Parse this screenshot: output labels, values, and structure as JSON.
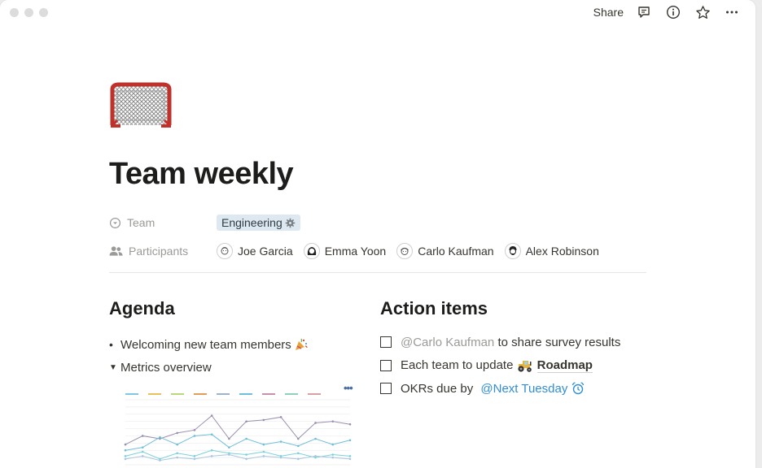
{
  "topbar": {
    "share_label": "Share",
    "icons": [
      "comment-icon",
      "info-icon",
      "star-icon",
      "more-icon"
    ]
  },
  "page": {
    "icon": "hockey-goal-icon",
    "title": "Team weekly"
  },
  "properties": {
    "team": {
      "label": "Team",
      "value": "Engineering"
    },
    "participants": {
      "label": "Participants",
      "people": [
        "Joe Garcia",
        "Emma Yoon",
        "Carlo Kaufman",
        "Alex Robinson"
      ]
    }
  },
  "agenda": {
    "heading": "Agenda",
    "items": [
      {
        "text": "Welcoming new team members",
        "emoji": "party-popper-icon"
      },
      {
        "text": "Metrics overview",
        "toggle": true
      }
    ]
  },
  "action_items": {
    "heading": "Action items",
    "items": [
      {
        "mention": "@Carlo Kaufman",
        "text": " to share survey results"
      },
      {
        "text": "Each team to update ",
        "link": "Roadmap",
        "link_icon": "tractor-icon"
      },
      {
        "text": "OKRs due by ",
        "date": "@Next Tuesday",
        "date_icon": "alarm-clock-icon"
      }
    ]
  },
  "colors": {
    "tag_bg": "#dde8f0",
    "mention_blue": "#2f8ed6",
    "muted": "#9b9a97"
  },
  "chart_data": {
    "type": "line",
    "x": [
      1,
      2,
      3,
      4,
      5,
      6,
      7,
      8,
      9,
      10,
      11,
      12,
      13,
      14
    ],
    "series": [
      {
        "values": [
          14,
          20,
          18,
          22,
          24,
          34,
          18,
          30,
          31,
          33,
          18,
          29,
          30,
          28
        ]
      },
      {
        "values": [
          10,
          12,
          19,
          14,
          20,
          21,
          12,
          18,
          14,
          16,
          13,
          18,
          14,
          17
        ]
      },
      {
        "values": [
          6,
          9,
          4,
          8,
          6,
          10,
          8,
          7,
          9,
          6,
          8,
          5,
          7,
          6
        ]
      },
      {
        "values": [
          4,
          6,
          3,
          5,
          4,
          6,
          7,
          4,
          6,
          5,
          4,
          6,
          5,
          4
        ]
      }
    ],
    "ylim": [
      0,
      45
    ],
    "grid": true
  }
}
